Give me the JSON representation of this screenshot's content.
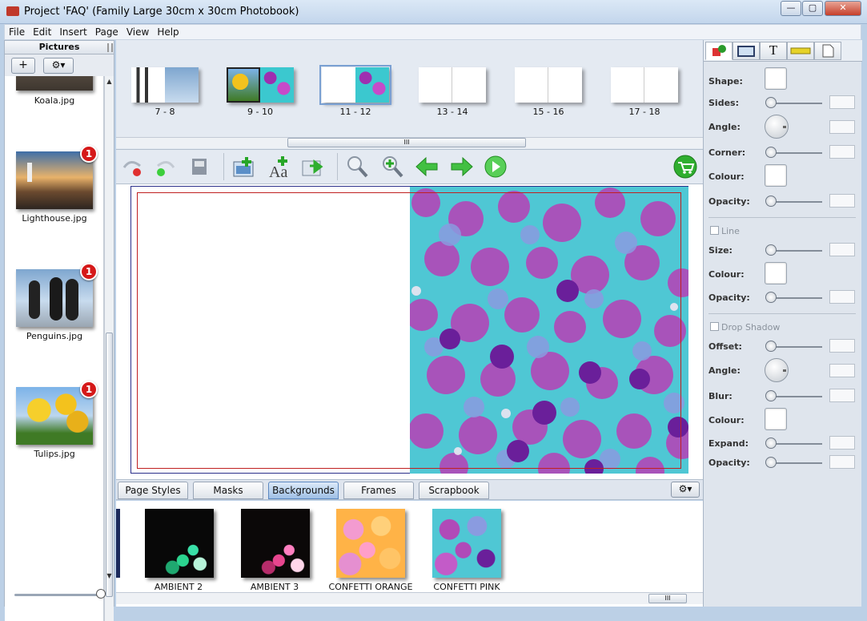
{
  "window": {
    "title": "Project 'FAQ' (Family Large 30cm x 30cm Photobook)",
    "minimize": "—",
    "maximize": "▢",
    "close": "✕"
  },
  "menu": [
    "File",
    "Edit",
    "Insert",
    "Page",
    "View",
    "Help"
  ],
  "pictures": {
    "header": "Pictures",
    "add_label": "+",
    "gear_label": "⚙▾",
    "items": [
      {
        "name": "Koala.jpg",
        "badge": ""
      },
      {
        "name": "Lighthouse.jpg",
        "badge": "1"
      },
      {
        "name": "Penguins.jpg",
        "badge": "1"
      },
      {
        "name": "Tulips.jpg",
        "badge": "1"
      }
    ]
  },
  "spreads": [
    {
      "label": "7 - 8"
    },
    {
      "label": "9 - 10"
    },
    {
      "label": "11 - 12",
      "selected": true
    },
    {
      "label": "13 - 14"
    },
    {
      "label": "15 - 16"
    },
    {
      "label": "17 - 18"
    }
  ],
  "scroll_grip": "III",
  "toolbar": [
    "undo-icon",
    "redo-icon",
    "save-page-icon",
    "add-picture-icon",
    "add-text-icon",
    "add-page-icon",
    "zoom-out-icon",
    "zoom-in-icon",
    "previous-page-icon",
    "next-page-icon",
    "play-preview-icon",
    "shopping-cart-icon"
  ],
  "tabs": [
    {
      "label": "Page Styles"
    },
    {
      "label": "Masks"
    },
    {
      "label": "Backgrounds",
      "active": true
    },
    {
      "label": "Frames"
    },
    {
      "label": "Scrapbook"
    }
  ],
  "tab_gear": "⚙▾",
  "backgrounds": [
    {
      "name": "AMBIENT 2"
    },
    {
      "name": "AMBIENT 3"
    },
    {
      "name": "CONFETTI ORANGE"
    },
    {
      "name": "CONFETTI PINK"
    }
  ],
  "properties": {
    "tabs": [
      "shape-tab-icon",
      "frame-tab-icon",
      "text-tab-icon",
      "ruler-tab-icon",
      "page-tab-icon"
    ],
    "text_tab_glyph": "T",
    "shape": "Shape:",
    "sides": "Sides:",
    "angle": "Angle:",
    "corner": "Corner:",
    "colour": "Colour:",
    "opacity": "Opacity:",
    "line": "Line",
    "size": "Size:",
    "drop_shadow": "Drop Shadow",
    "offset": "Offset:",
    "blur": "Blur:",
    "expand": "Expand:"
  },
  "colors": {
    "accent": "#5b87c0",
    "badge": "#d51919",
    "margin": "#c02020"
  }
}
